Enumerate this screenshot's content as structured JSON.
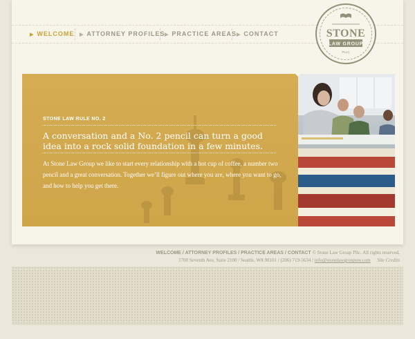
{
  "nav": {
    "items": [
      {
        "label": "WELCOME",
        "active": true
      },
      {
        "label": "ATTORNEY PROFILES",
        "active": false
      },
      {
        "label": "PRACTICE AREAS",
        "active": false
      },
      {
        "label": "CONTACT",
        "active": false
      }
    ],
    "arrow_glyph": "▶"
  },
  "logo": {
    "name": "STONE",
    "sub": "LAW GROUP",
    "suffix": "PLLC",
    "icon": "book-icon",
    "color": "#8f9178"
  },
  "hero": {
    "rule_label": "STONE LAW RULE NO. 2",
    "headline": "A conversation and a No. 2 pencil can turn a good idea into a rock solid foundation in a few minutes.",
    "body": "At Stone Law Group we like to start every relationship with a hot cup of coffee, a number two pencil and a great conversation. Together we’ll figure out where you are, where you want to go, and how to help you get there.",
    "accent": "#d2a94f"
  },
  "footer": {
    "links": [
      "WELCOME",
      "ATTORNEY PROFILES",
      "PRACTICE AREAS",
      "CONTACT"
    ],
    "separator": " / ",
    "copyright": "© Stone Law Group Pllc. All rights reserved.",
    "address": "1700 Seventh Ave, Suite 2100 / Seattle, WA 98101 / (206) 719-5634 /",
    "email": "info@stonelawgroupuw.com",
    "credits": "Site Credits"
  }
}
